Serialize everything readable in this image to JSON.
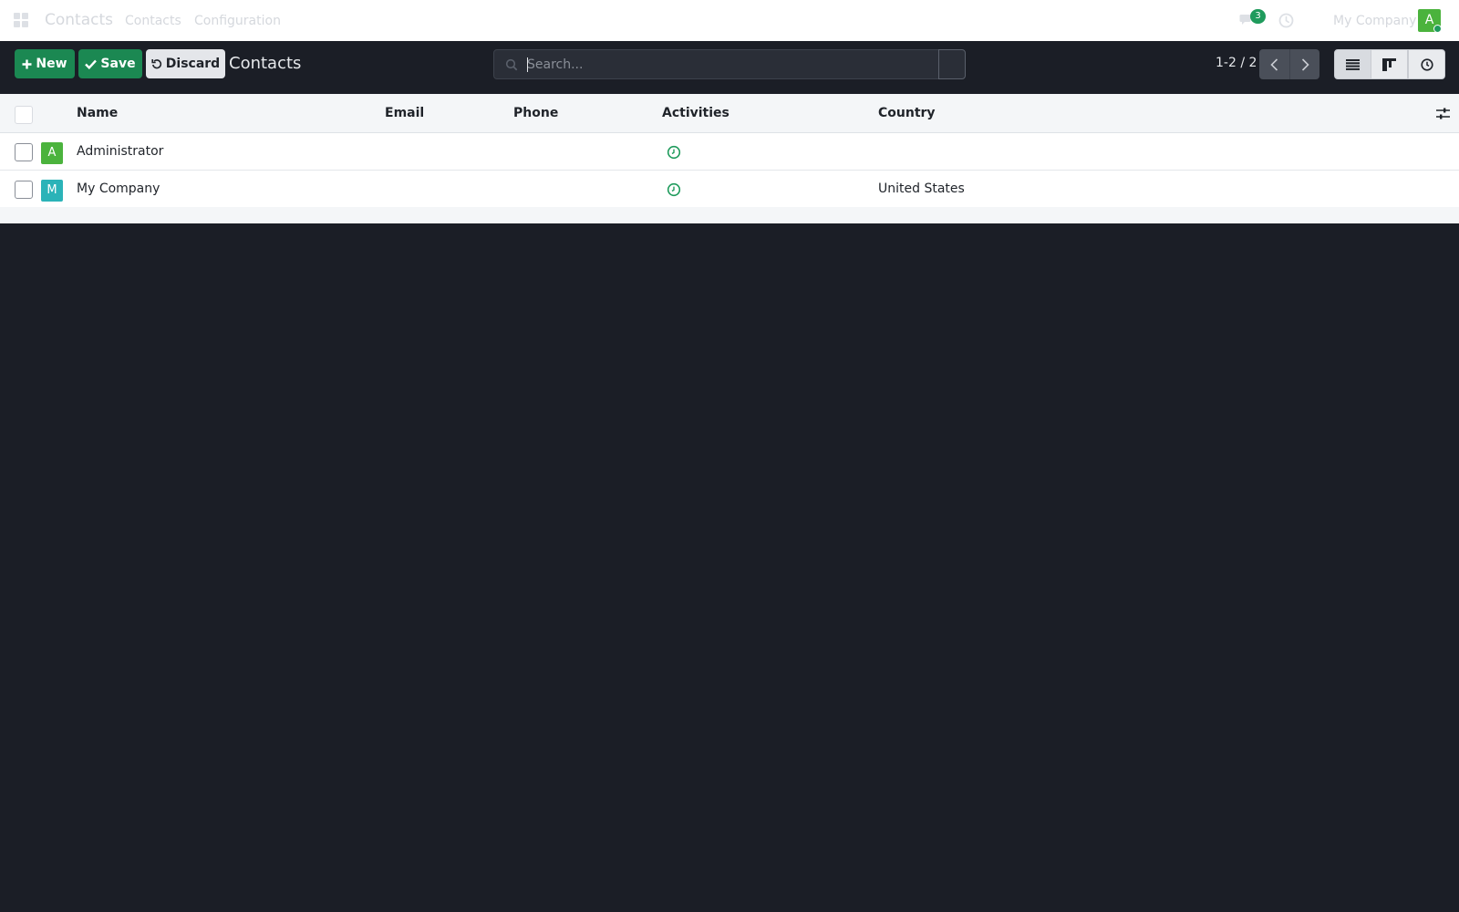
{
  "navbar": {
    "brand": "Contacts",
    "menu": [
      "Contacts",
      "Configuration"
    ],
    "chat_count": "3",
    "company": "My Company",
    "user_initial": "A"
  },
  "control_panel": {
    "new_label": "New",
    "save_label": "Save",
    "discard_label": "Discard",
    "title": "Contacts",
    "search_placeholder": "Search...",
    "pager_value": "1-2 / 2"
  },
  "list": {
    "columns": [
      "Name",
      "Email",
      "Phone",
      "Activities",
      "Country"
    ],
    "rows": [
      {
        "initial": "A",
        "avatar_color": "#4bb33d",
        "name": "Administrator",
        "email": "",
        "phone": "",
        "country": ""
      },
      {
        "initial": "M",
        "avatar_color": "#2bb3b8",
        "name": "My Company",
        "email": "",
        "phone": "",
        "country": "United States"
      }
    ]
  },
  "colors": {
    "primary": "#1b8852",
    "background": "#1b1e26",
    "activity": "#1f9b5c"
  }
}
